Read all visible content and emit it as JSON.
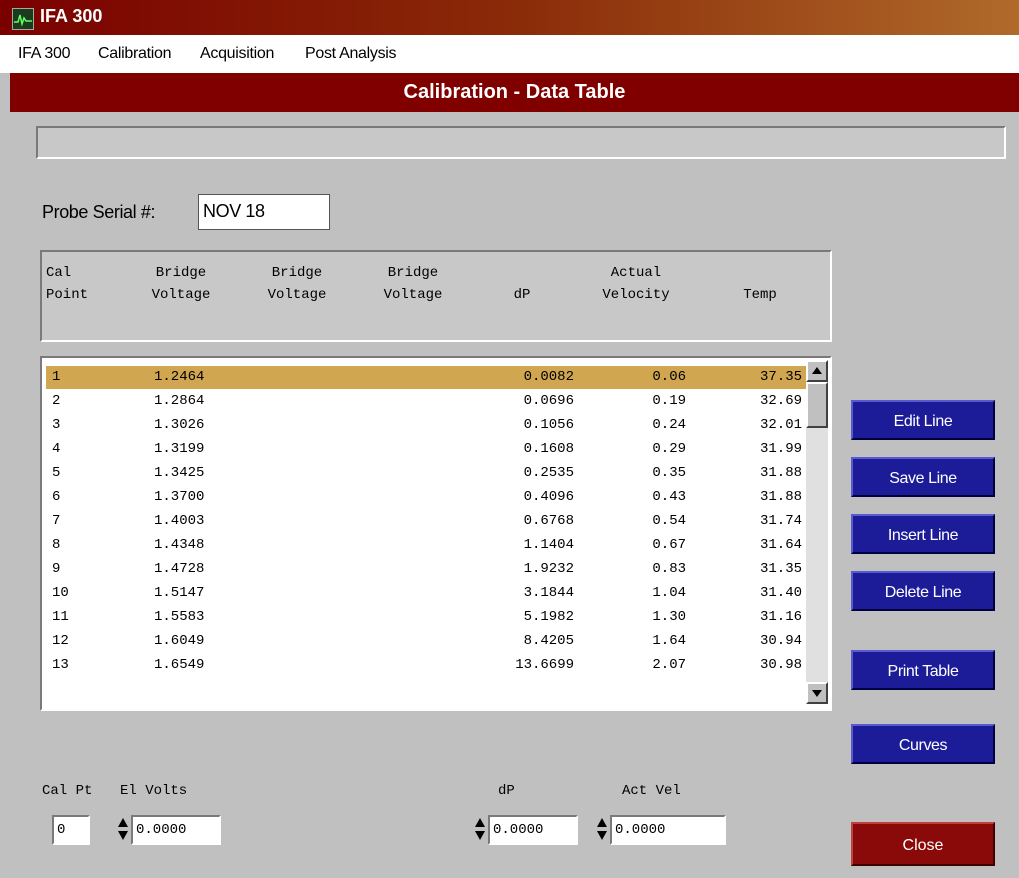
{
  "app": {
    "title": "IFA 300"
  },
  "menu": [
    "IFA 300",
    "Calibration",
    "Acquisition",
    "Post Analysis"
  ],
  "panel_title": "Calibration - Data Table",
  "status_text": "",
  "probe": {
    "label": "Probe Serial #:",
    "value": "NOV 18"
  },
  "columns": [
    {
      "line1": "Cal",
      "line2": "Point"
    },
    {
      "line1": "Bridge",
      "line2": "Voltage"
    },
    {
      "line1": "Bridge",
      "line2": "Voltage"
    },
    {
      "line1": "Bridge",
      "line2": "Voltage"
    },
    {
      "line1": "",
      "line2": "dP"
    },
    {
      "line1": "Actual",
      "line2": "Velocity"
    },
    {
      "line1": "",
      "line2": "Temp"
    }
  ],
  "rows": [
    {
      "pt": "1",
      "v1": "1.2464",
      "dp": "0.0082",
      "vel": "0.06",
      "temp": "37.35"
    },
    {
      "pt": "2",
      "v1": "1.2864",
      "dp": "0.0696",
      "vel": "0.19",
      "temp": "32.69"
    },
    {
      "pt": "3",
      "v1": "1.3026",
      "dp": "0.1056",
      "vel": "0.24",
      "temp": "32.01"
    },
    {
      "pt": "4",
      "v1": "1.3199",
      "dp": "0.1608",
      "vel": "0.29",
      "temp": "31.99"
    },
    {
      "pt": "5",
      "v1": "1.3425",
      "dp": "0.2535",
      "vel": "0.35",
      "temp": "31.88"
    },
    {
      "pt": "6",
      "v1": "1.3700",
      "dp": "0.4096",
      "vel": "0.43",
      "temp": "31.88"
    },
    {
      "pt": "7",
      "v1": "1.4003",
      "dp": "0.6768",
      "vel": "0.54",
      "temp": "31.74"
    },
    {
      "pt": "8",
      "v1": "1.4348",
      "dp": "1.1404",
      "vel": "0.67",
      "temp": "31.64"
    },
    {
      "pt": "9",
      "v1": "1.4728",
      "dp": "1.9232",
      "vel": "0.83",
      "temp": "31.35"
    },
    {
      "pt": "10",
      "v1": "1.5147",
      "dp": "3.1844",
      "vel": "1.04",
      "temp": "31.40"
    },
    {
      "pt": "11",
      "v1": "1.5583",
      "dp": "5.1982",
      "vel": "1.30",
      "temp": "31.16"
    },
    {
      "pt": "12",
      "v1": "1.6049",
      "dp": "8.4205",
      "vel": "1.64",
      "temp": "30.94"
    },
    {
      "pt": "13",
      "v1": "1.6549",
      "dp": "13.6699",
      "vel": "2.07",
      "temp": "30.98"
    }
  ],
  "buttons": {
    "edit": "Edit Line",
    "save": "Save Line",
    "insert": "Insert Line",
    "delete": "Delete Line",
    "print": "Print Table",
    "curves": "Curves",
    "close": "Close"
  },
  "fields": {
    "cal_pt_label": "Cal Pt",
    "cal_pt_value": "0",
    "el_volts_label": "El Volts",
    "el_volts_value": "0.0000",
    "dp_label": "dP",
    "dp_value": "0.0000",
    "act_vel_label": "Act Vel",
    "act_vel_value": "0.0000"
  },
  "colors": {
    "title_bar": "#800000",
    "selected_row": "#d1a651",
    "action_button": "#1c1c99",
    "close_button": "#8a0a0a"
  },
  "icons": {
    "app": "waveform-app-icon",
    "scroll_up": "arrow-up-icon",
    "scroll_down": "arrow-down-icon",
    "spinner": "spinner-arrows-icon"
  }
}
